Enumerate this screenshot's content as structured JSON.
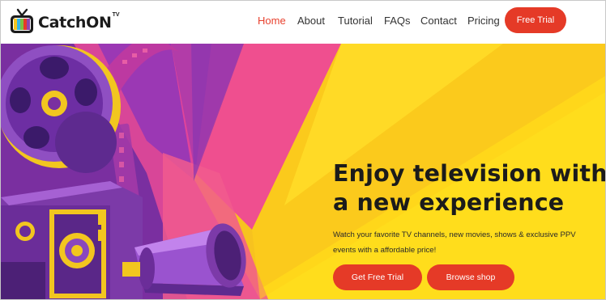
{
  "brand": {
    "name": "CatchON",
    "superscript": "TV"
  },
  "nav": {
    "items": [
      {
        "label": "Home",
        "active": true
      },
      {
        "label": "About",
        "active": false
      },
      {
        "label": "Tutorial",
        "active": false
      },
      {
        "label": "FAQs",
        "active": false
      },
      {
        "label": "Contact",
        "active": false
      },
      {
        "label": "Pricing",
        "active": false
      }
    ],
    "cta_label": "Free Trial"
  },
  "hero": {
    "headline_line1": "Enjoy television with",
    "headline_line2": "a new experience",
    "sub_line1": "Watch your favorite TV channels, new movies, shows & exclusive PPV",
    "sub_line2": "events with a affordable price!",
    "primary_button": "Get Free Trial",
    "secondary_button": "Browse shop"
  },
  "colors": {
    "accent": "#e53a27",
    "active_nav": "#e8412e",
    "hero_yellow": "#ffdd1c",
    "hero_purple": "#7a2fa0",
    "hero_pink": "#e0449a",
    "text_dark": "#1b1b1b"
  },
  "icons": [
    "tv-logo-icon",
    "film-projector-illustration"
  ]
}
